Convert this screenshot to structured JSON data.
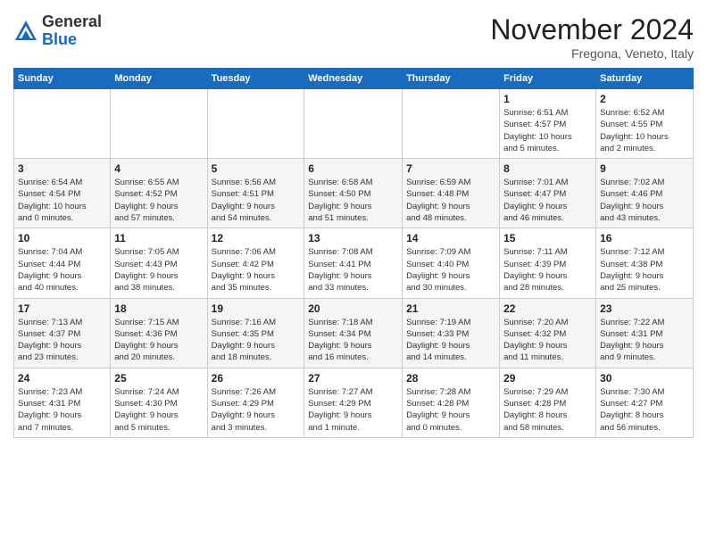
{
  "logo": {
    "general": "General",
    "blue": "Blue"
  },
  "header": {
    "month": "November 2024",
    "location": "Fregona, Veneto, Italy"
  },
  "weekdays": [
    "Sunday",
    "Monday",
    "Tuesday",
    "Wednesday",
    "Thursday",
    "Friday",
    "Saturday"
  ],
  "weeks": [
    [
      {
        "day": "",
        "info": ""
      },
      {
        "day": "",
        "info": ""
      },
      {
        "day": "",
        "info": ""
      },
      {
        "day": "",
        "info": ""
      },
      {
        "day": "",
        "info": ""
      },
      {
        "day": "1",
        "info": "Sunrise: 6:51 AM\nSunset: 4:57 PM\nDaylight: 10 hours\nand 5 minutes."
      },
      {
        "day": "2",
        "info": "Sunrise: 6:52 AM\nSunset: 4:55 PM\nDaylight: 10 hours\nand 2 minutes."
      }
    ],
    [
      {
        "day": "3",
        "info": "Sunrise: 6:54 AM\nSunset: 4:54 PM\nDaylight: 10 hours\nand 0 minutes."
      },
      {
        "day": "4",
        "info": "Sunrise: 6:55 AM\nSunset: 4:52 PM\nDaylight: 9 hours\nand 57 minutes."
      },
      {
        "day": "5",
        "info": "Sunrise: 6:56 AM\nSunset: 4:51 PM\nDaylight: 9 hours\nand 54 minutes."
      },
      {
        "day": "6",
        "info": "Sunrise: 6:58 AM\nSunset: 4:50 PM\nDaylight: 9 hours\nand 51 minutes."
      },
      {
        "day": "7",
        "info": "Sunrise: 6:59 AM\nSunset: 4:48 PM\nDaylight: 9 hours\nand 48 minutes."
      },
      {
        "day": "8",
        "info": "Sunrise: 7:01 AM\nSunset: 4:47 PM\nDaylight: 9 hours\nand 46 minutes."
      },
      {
        "day": "9",
        "info": "Sunrise: 7:02 AM\nSunset: 4:46 PM\nDaylight: 9 hours\nand 43 minutes."
      }
    ],
    [
      {
        "day": "10",
        "info": "Sunrise: 7:04 AM\nSunset: 4:44 PM\nDaylight: 9 hours\nand 40 minutes."
      },
      {
        "day": "11",
        "info": "Sunrise: 7:05 AM\nSunset: 4:43 PM\nDaylight: 9 hours\nand 38 minutes."
      },
      {
        "day": "12",
        "info": "Sunrise: 7:06 AM\nSunset: 4:42 PM\nDaylight: 9 hours\nand 35 minutes."
      },
      {
        "day": "13",
        "info": "Sunrise: 7:08 AM\nSunset: 4:41 PM\nDaylight: 9 hours\nand 33 minutes."
      },
      {
        "day": "14",
        "info": "Sunrise: 7:09 AM\nSunset: 4:40 PM\nDaylight: 9 hours\nand 30 minutes."
      },
      {
        "day": "15",
        "info": "Sunrise: 7:11 AM\nSunset: 4:39 PM\nDaylight: 9 hours\nand 28 minutes."
      },
      {
        "day": "16",
        "info": "Sunrise: 7:12 AM\nSunset: 4:38 PM\nDaylight: 9 hours\nand 25 minutes."
      }
    ],
    [
      {
        "day": "17",
        "info": "Sunrise: 7:13 AM\nSunset: 4:37 PM\nDaylight: 9 hours\nand 23 minutes."
      },
      {
        "day": "18",
        "info": "Sunrise: 7:15 AM\nSunset: 4:36 PM\nDaylight: 9 hours\nand 20 minutes."
      },
      {
        "day": "19",
        "info": "Sunrise: 7:16 AM\nSunset: 4:35 PM\nDaylight: 9 hours\nand 18 minutes."
      },
      {
        "day": "20",
        "info": "Sunrise: 7:18 AM\nSunset: 4:34 PM\nDaylight: 9 hours\nand 16 minutes."
      },
      {
        "day": "21",
        "info": "Sunrise: 7:19 AM\nSunset: 4:33 PM\nDaylight: 9 hours\nand 14 minutes."
      },
      {
        "day": "22",
        "info": "Sunrise: 7:20 AM\nSunset: 4:32 PM\nDaylight: 9 hours\nand 11 minutes."
      },
      {
        "day": "23",
        "info": "Sunrise: 7:22 AM\nSunset: 4:31 PM\nDaylight: 9 hours\nand 9 minutes."
      }
    ],
    [
      {
        "day": "24",
        "info": "Sunrise: 7:23 AM\nSunset: 4:31 PM\nDaylight: 9 hours\nand 7 minutes."
      },
      {
        "day": "25",
        "info": "Sunrise: 7:24 AM\nSunset: 4:30 PM\nDaylight: 9 hours\nand 5 minutes."
      },
      {
        "day": "26",
        "info": "Sunrise: 7:26 AM\nSunset: 4:29 PM\nDaylight: 9 hours\nand 3 minutes."
      },
      {
        "day": "27",
        "info": "Sunrise: 7:27 AM\nSunset: 4:29 PM\nDaylight: 9 hours\nand 1 minute."
      },
      {
        "day": "28",
        "info": "Sunrise: 7:28 AM\nSunset: 4:28 PM\nDaylight: 9 hours\nand 0 minutes."
      },
      {
        "day": "29",
        "info": "Sunrise: 7:29 AM\nSunset: 4:28 PM\nDaylight: 8 hours\nand 58 minutes."
      },
      {
        "day": "30",
        "info": "Sunrise: 7:30 AM\nSunset: 4:27 PM\nDaylight: 8 hours\nand 56 minutes."
      }
    ]
  ]
}
